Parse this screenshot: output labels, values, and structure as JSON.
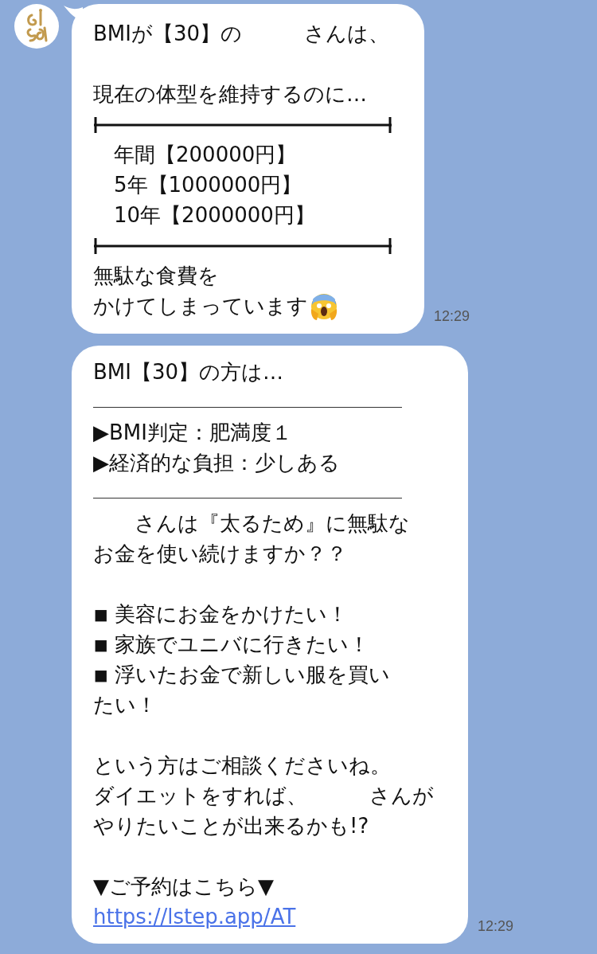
{
  "messages": [
    {
      "avatar": true,
      "time": "12:29",
      "rows": [
        {
          "kind": "text",
          "text": "BMIが【30】の　　　さんは、"
        },
        {
          "kind": "blank"
        },
        {
          "kind": "text",
          "text": "現在の体型を維持するのに…"
        },
        {
          "kind": "tick-rule"
        },
        {
          "kind": "text",
          "text": "　年間【200000円】"
        },
        {
          "kind": "text",
          "text": "　5年【1000000円】"
        },
        {
          "kind": "text",
          "text": "　10年【2000000円】"
        },
        {
          "kind": "tick-rule"
        },
        {
          "kind": "text",
          "text": "無駄な食費を"
        },
        {
          "kind": "text-emoji",
          "text": "かけてしまっています"
        }
      ]
    },
    {
      "avatar": false,
      "time": "12:29",
      "rows": [
        {
          "kind": "text",
          "text": "BMI【30】の方は…"
        },
        {
          "kind": "underscore-rule"
        },
        {
          "kind": "text",
          "text": "▶BMI判定：肥満度１"
        },
        {
          "kind": "text",
          "text": "▶経済的な負担：少しある"
        },
        {
          "kind": "underscore-rule"
        },
        {
          "kind": "text",
          "text": "　　さんは『太るため』に無駄な"
        },
        {
          "kind": "text",
          "text": "お金を使い続けますか？？"
        },
        {
          "kind": "blank"
        },
        {
          "kind": "text",
          "text": "◾ 美容にお金をかけたい！"
        },
        {
          "kind": "text",
          "text": "◾ 家族でユニバに行きたい！"
        },
        {
          "kind": "text",
          "text": "◾ 浮いたお金で新しい服を買い"
        },
        {
          "kind": "text",
          "text": "たい！"
        },
        {
          "kind": "blank"
        },
        {
          "kind": "text",
          "text": "という方はご相談くださいね。"
        },
        {
          "kind": "text",
          "text": "ダイエットをすれば、　　　さんが"
        },
        {
          "kind": "text",
          "text": "やりたいことが出来るかも!?"
        },
        {
          "kind": "blank"
        },
        {
          "kind": "text",
          "text": "▼ご予約はこちら▼"
        },
        {
          "kind": "link",
          "text": "https://lstep.app/AT"
        }
      ]
    }
  ]
}
